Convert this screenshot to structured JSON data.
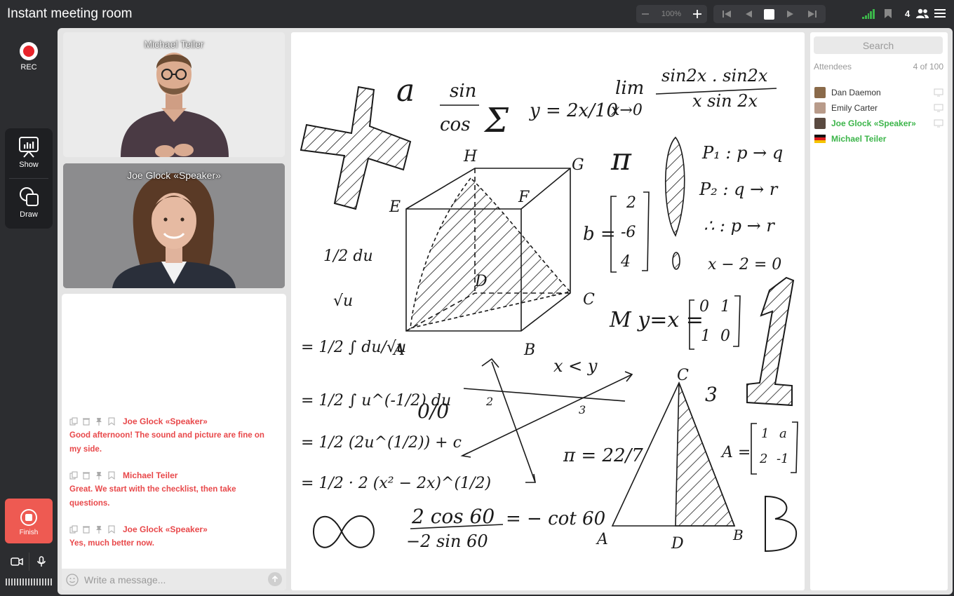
{
  "header": {
    "title": "Instant meeting room",
    "zoom": "100%",
    "attendee_count": "4",
    "signal_color": "#3cb54a"
  },
  "sidebar": {
    "rec_label": "REC",
    "show_label": "Show",
    "draw_label": "Draw",
    "finish_label": "Finish"
  },
  "videos": [
    {
      "name": "Michael Teiler"
    },
    {
      "name": "Joe Glock «Speaker»"
    }
  ],
  "chat": {
    "messages": [
      {
        "author": "Joe Glock «Speaker»",
        "text": "Good afternoon! The sound and picture are fine on my side."
      },
      {
        "author": "Michael Teiler",
        "text": "Great. We start with the checklist, then take questions."
      },
      {
        "author": "Joe Glock «Speaker»",
        "text": "Yes, much better now."
      }
    ],
    "placeholder": "Write a message...",
    "accent_color": "#e8484a"
  },
  "attendees": {
    "search_placeholder": "Search",
    "label": "Attendees",
    "count": "4 of 100",
    "list": [
      {
        "name": "Dan Daemon",
        "highlight": false
      },
      {
        "name": "Emily Carter",
        "highlight": false
      },
      {
        "name": "Joe Glock «Speaker»",
        "highlight": true
      },
      {
        "name": "Michael Teiler",
        "highlight": true
      }
    ],
    "highlight_color": "#3cb54a"
  },
  "whiteboard": {
    "labels": [
      "a",
      "sin",
      "cos",
      "Σ",
      "y = 2x/10",
      "lim",
      "x→0",
      "sin2x . sin2x",
      "x sin 2x",
      "H",
      "G",
      "E",
      "F",
      "D",
      "A",
      "B",
      "C",
      "π",
      "P₁ : p → q",
      "P₂ : q → r",
      "∴ : p → r",
      "x − 2 = 0",
      "b =",
      "2",
      "-6",
      "4",
      "M y=x =",
      "0",
      "1",
      "1",
      "0",
      "1/2 du",
      "√u",
      "= 1/2 ∫ du/√u",
      "= 1/2 ∫ u^(-1/2) du",
      "= 1/2 (2u^(1/2)) + c",
      "= 1/2 · 2 (x² − 2x)^(1/2)",
      "0/0",
      "x < y",
      "2",
      "3",
      "π = 22/7",
      "3",
      "A =",
      "1",
      "a",
      "2",
      "-1",
      "C",
      "A",
      "D",
      "B",
      "2 cos 60",
      "−2 sin 60",
      "= − cot 60",
      "∞",
      "B"
    ]
  }
}
